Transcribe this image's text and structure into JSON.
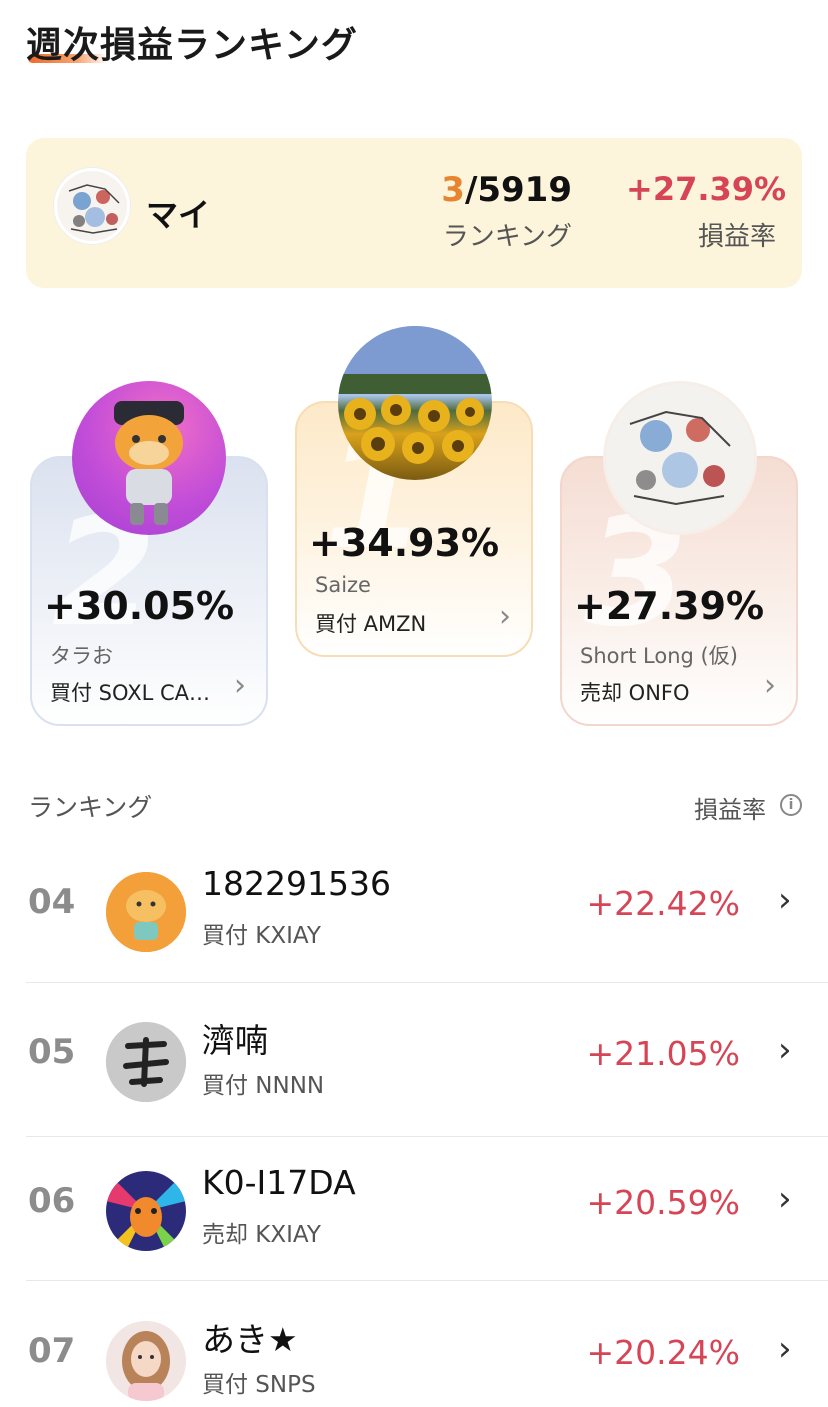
{
  "header": {
    "title": "週次損益ランキング"
  },
  "my_card": {
    "name": "マイ",
    "rank_current": "3",
    "rank_total": "/5919",
    "rank_label": "ランキング",
    "rate": "+27.39%",
    "rate_label": "損益率"
  },
  "podium": [
    {
      "place": "2",
      "percent": "+30.05%",
      "name": "タラお",
      "trade": "買付 SOXL CA…",
      "avatar_icon": "cow-mascot-avatar"
    },
    {
      "place": "1",
      "percent": "+34.93%",
      "name": "Saize",
      "trade": "買付 AMZN",
      "avatar_icon": "sunflower-photo-avatar"
    },
    {
      "place": "3",
      "percent": "+27.39%",
      "name": "Short Long (仮)",
      "trade": "売却 ONFO",
      "avatar_icon": "doodle-art-avatar"
    }
  ],
  "list_header": {
    "left": "ランキング",
    "right": "損益率"
  },
  "rows": [
    {
      "rank": "04",
      "name": "182291536",
      "trade": "買付 KXIAY",
      "percent": "+22.42%",
      "avatar_icon": "cow-mascot-avatar"
    },
    {
      "rank": "05",
      "name": "濟喃",
      "trade": "買付 NNNN",
      "percent": "+21.05%",
      "avatar_icon": "calligraphy-avatar"
    },
    {
      "rank": "06",
      "name": "K0-I17DA",
      "trade": "売却 KXIAY",
      "percent": "+20.59%",
      "avatar_icon": "colorful-lion-avatar"
    },
    {
      "rank": "07",
      "name": "あき★",
      "trade": "買付 SNPS",
      "percent": "+20.24%",
      "avatar_icon": "portrait-avatar"
    }
  ],
  "colors": {
    "accent_orange": "#e8842f",
    "gain_red": "#d64555",
    "card_cream": "#fdf4dc"
  }
}
